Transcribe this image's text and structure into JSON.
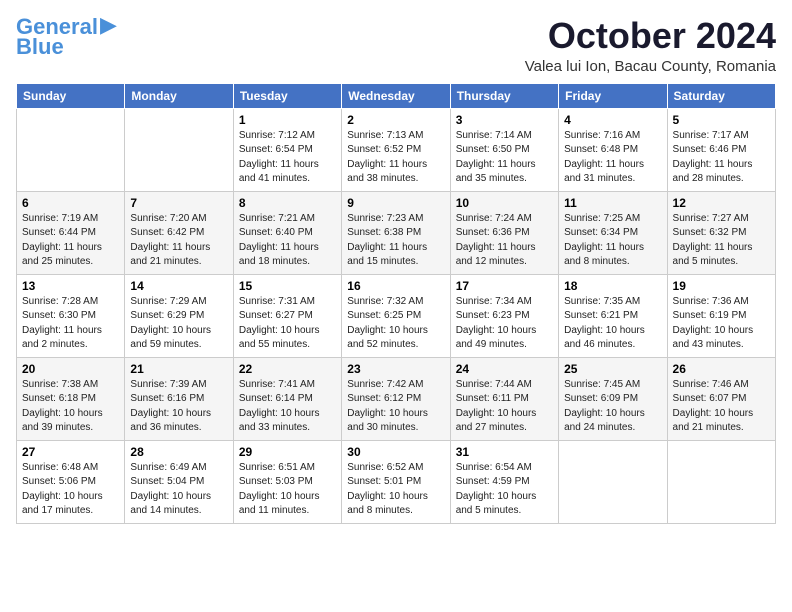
{
  "logo": {
    "line1": "General",
    "line2": "Blue"
  },
  "title": "October 2024",
  "location": "Valea lui Ion, Bacau County, Romania",
  "days_of_week": [
    "Sunday",
    "Monday",
    "Tuesday",
    "Wednesday",
    "Thursday",
    "Friday",
    "Saturday"
  ],
  "weeks": [
    [
      {
        "day": "",
        "info": ""
      },
      {
        "day": "",
        "info": ""
      },
      {
        "day": "1",
        "info": "Sunrise: 7:12 AM\nSunset: 6:54 PM\nDaylight: 11 hours and 41 minutes."
      },
      {
        "day": "2",
        "info": "Sunrise: 7:13 AM\nSunset: 6:52 PM\nDaylight: 11 hours and 38 minutes."
      },
      {
        "day": "3",
        "info": "Sunrise: 7:14 AM\nSunset: 6:50 PM\nDaylight: 11 hours and 35 minutes."
      },
      {
        "day": "4",
        "info": "Sunrise: 7:16 AM\nSunset: 6:48 PM\nDaylight: 11 hours and 31 minutes."
      },
      {
        "day": "5",
        "info": "Sunrise: 7:17 AM\nSunset: 6:46 PM\nDaylight: 11 hours and 28 minutes."
      }
    ],
    [
      {
        "day": "6",
        "info": "Sunrise: 7:19 AM\nSunset: 6:44 PM\nDaylight: 11 hours and 25 minutes."
      },
      {
        "day": "7",
        "info": "Sunrise: 7:20 AM\nSunset: 6:42 PM\nDaylight: 11 hours and 21 minutes."
      },
      {
        "day": "8",
        "info": "Sunrise: 7:21 AM\nSunset: 6:40 PM\nDaylight: 11 hours and 18 minutes."
      },
      {
        "day": "9",
        "info": "Sunrise: 7:23 AM\nSunset: 6:38 PM\nDaylight: 11 hours and 15 minutes."
      },
      {
        "day": "10",
        "info": "Sunrise: 7:24 AM\nSunset: 6:36 PM\nDaylight: 11 hours and 12 minutes."
      },
      {
        "day": "11",
        "info": "Sunrise: 7:25 AM\nSunset: 6:34 PM\nDaylight: 11 hours and 8 minutes."
      },
      {
        "day": "12",
        "info": "Sunrise: 7:27 AM\nSunset: 6:32 PM\nDaylight: 11 hours and 5 minutes."
      }
    ],
    [
      {
        "day": "13",
        "info": "Sunrise: 7:28 AM\nSunset: 6:30 PM\nDaylight: 11 hours and 2 minutes."
      },
      {
        "day": "14",
        "info": "Sunrise: 7:29 AM\nSunset: 6:29 PM\nDaylight: 10 hours and 59 minutes."
      },
      {
        "day": "15",
        "info": "Sunrise: 7:31 AM\nSunset: 6:27 PM\nDaylight: 10 hours and 55 minutes."
      },
      {
        "day": "16",
        "info": "Sunrise: 7:32 AM\nSunset: 6:25 PM\nDaylight: 10 hours and 52 minutes."
      },
      {
        "day": "17",
        "info": "Sunrise: 7:34 AM\nSunset: 6:23 PM\nDaylight: 10 hours and 49 minutes."
      },
      {
        "day": "18",
        "info": "Sunrise: 7:35 AM\nSunset: 6:21 PM\nDaylight: 10 hours and 46 minutes."
      },
      {
        "day": "19",
        "info": "Sunrise: 7:36 AM\nSunset: 6:19 PM\nDaylight: 10 hours and 43 minutes."
      }
    ],
    [
      {
        "day": "20",
        "info": "Sunrise: 7:38 AM\nSunset: 6:18 PM\nDaylight: 10 hours and 39 minutes."
      },
      {
        "day": "21",
        "info": "Sunrise: 7:39 AM\nSunset: 6:16 PM\nDaylight: 10 hours and 36 minutes."
      },
      {
        "day": "22",
        "info": "Sunrise: 7:41 AM\nSunset: 6:14 PM\nDaylight: 10 hours and 33 minutes."
      },
      {
        "day": "23",
        "info": "Sunrise: 7:42 AM\nSunset: 6:12 PM\nDaylight: 10 hours and 30 minutes."
      },
      {
        "day": "24",
        "info": "Sunrise: 7:44 AM\nSunset: 6:11 PM\nDaylight: 10 hours and 27 minutes."
      },
      {
        "day": "25",
        "info": "Sunrise: 7:45 AM\nSunset: 6:09 PM\nDaylight: 10 hours and 24 minutes."
      },
      {
        "day": "26",
        "info": "Sunrise: 7:46 AM\nSunset: 6:07 PM\nDaylight: 10 hours and 21 minutes."
      }
    ],
    [
      {
        "day": "27",
        "info": "Sunrise: 6:48 AM\nSunset: 5:06 PM\nDaylight: 10 hours and 17 minutes."
      },
      {
        "day": "28",
        "info": "Sunrise: 6:49 AM\nSunset: 5:04 PM\nDaylight: 10 hours and 14 minutes."
      },
      {
        "day": "29",
        "info": "Sunrise: 6:51 AM\nSunset: 5:03 PM\nDaylight: 10 hours and 11 minutes."
      },
      {
        "day": "30",
        "info": "Sunrise: 6:52 AM\nSunset: 5:01 PM\nDaylight: 10 hours and 8 minutes."
      },
      {
        "day": "31",
        "info": "Sunrise: 6:54 AM\nSunset: 4:59 PM\nDaylight: 10 hours and 5 minutes."
      },
      {
        "day": "",
        "info": ""
      },
      {
        "day": "",
        "info": ""
      }
    ]
  ]
}
